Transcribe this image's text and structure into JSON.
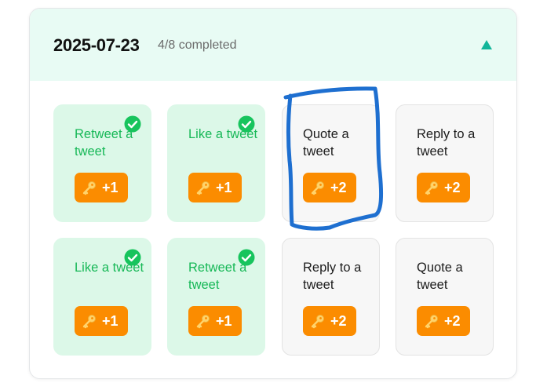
{
  "header": {
    "date": "2025-07-23",
    "progress": "4/8 completed",
    "toggle_icon": "caret-up-icon"
  },
  "colors": {
    "header_bg": "#e8fbf4",
    "accent_green": "#17b857",
    "done_bg": "#dcf8e8",
    "reward_orange": "#fb8c00",
    "toggle_teal": "#12b59a",
    "annotation_blue": "#1e6fd0"
  },
  "tasks": [
    {
      "label": "Retweet a tweet",
      "reward": "+1",
      "completed": true,
      "icon": "key-icon"
    },
    {
      "label": "Like a tweet",
      "reward": "+1",
      "completed": true,
      "icon": "key-icon"
    },
    {
      "label": "Quote a tweet",
      "reward": "+2",
      "completed": false,
      "icon": "key-icon"
    },
    {
      "label": "Reply to a tweet",
      "reward": "+2",
      "completed": false,
      "icon": "key-icon"
    },
    {
      "label": "Like a tweet",
      "reward": "+1",
      "completed": true,
      "icon": "key-icon"
    },
    {
      "label": "Retweet a tweet",
      "reward": "+1",
      "completed": true,
      "icon": "key-icon"
    },
    {
      "label": "Reply to a tweet",
      "reward": "+2",
      "completed": false,
      "icon": "key-icon"
    },
    {
      "label": "Quote a tweet",
      "reward": "+2",
      "completed": false,
      "icon": "key-icon"
    }
  ]
}
